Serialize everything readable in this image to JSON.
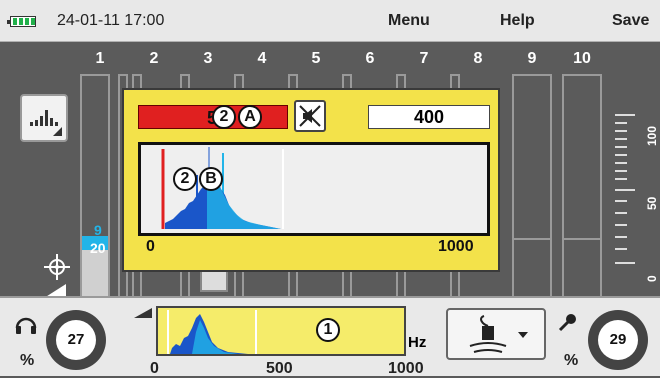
{
  "topbar": {
    "datetime": "24-01-11 17:00",
    "menu": "Menu",
    "help": "Help",
    "save": "Save"
  },
  "channels": [
    "1",
    "2",
    "3",
    "4",
    "5",
    "6",
    "7",
    "8",
    "9",
    "10"
  ],
  "scale_labels": [
    "100",
    "50",
    "0"
  ],
  "left_readout": {
    "top": "9",
    "bottom": "20"
  },
  "popup": {
    "red_value": "50",
    "badge_a": "2",
    "label_a": "A",
    "number_box": "400",
    "badge_b": "2",
    "label_b": "B",
    "axis_min": "0",
    "axis_max": "1000"
  },
  "bottom": {
    "left_dial": "27",
    "right_dial": "29",
    "percent_left": "%",
    "percent_right": "%",
    "mini_label": "1",
    "hz": "Hz",
    "axis_0": "0",
    "axis_500": "500",
    "axis_1000": "1000"
  },
  "colors": {
    "accent_yellow": "#f3e24a",
    "red": "#e02020",
    "cyan": "#22b4e8",
    "blue": "#1a56c9"
  }
}
